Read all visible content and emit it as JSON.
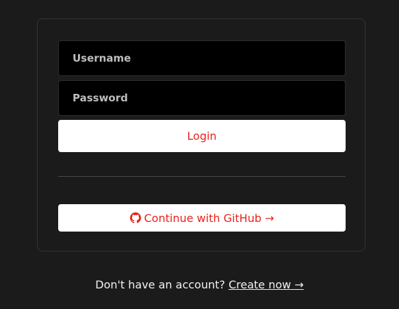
{
  "form": {
    "username_placeholder": "Username",
    "password_placeholder": "Password",
    "login_label": "Login",
    "github_label": "Continue with GitHub →"
  },
  "footer": {
    "prompt": "Don't have an account?",
    "link_label": "Create now →"
  },
  "colors": {
    "background": "#1b1b1b",
    "input_background": "#000000",
    "button_background": "#ffffff",
    "accent": "#e8231c"
  },
  "icons": {
    "github": "github-icon"
  }
}
